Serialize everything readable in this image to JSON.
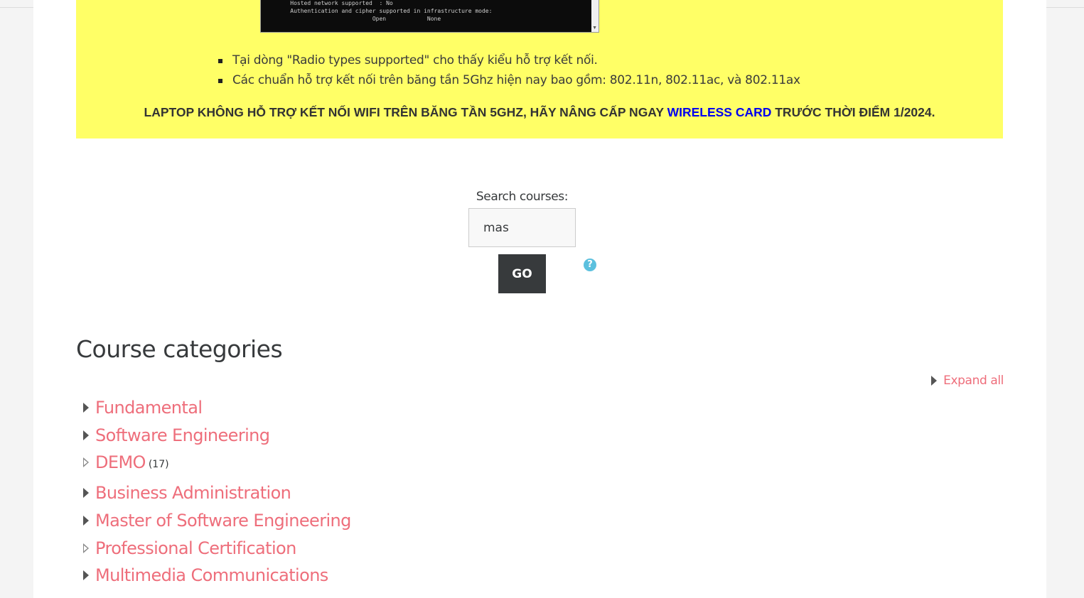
{
  "terminal": {
    "lines": [
      "    Hosted network supported  : No",
      "    Authentication and cipher supported in infrastructure mode:",
      "                            Open            None"
    ]
  },
  "notice": {
    "bullets": [
      "Tại dòng \"Radio types supported\" cho thấy kiểu hỗ trợ kết nối.",
      "Các chuẩn hỗ trợ kết nối trên băng tần 5Ghz hiện nay bao gồm: 802.11n, 802.11ac, và 802.11ax"
    ],
    "warning_before": "LAPTOP KHÔNG HỖ TRỢ KẾT NỐI WIFI TRÊN BĂNG TẦN 5GHZ, HÃY NÂNG CẤP NGAY ",
    "warning_link": "WIRELESS CARD",
    "warning_after": " TRƯỚC THỜI ĐIỂM 1/2024."
  },
  "search": {
    "label": "Search courses:",
    "value": "mas",
    "go_label": "GO",
    "help_glyph": "?"
  },
  "categories": {
    "heading": "Course categories",
    "expand_all": "Expand all",
    "items": [
      {
        "label": "Fundamental",
        "count": "",
        "icon": "collapsed-arrow-icon"
      },
      {
        "label": "Software Engineering",
        "count": "",
        "icon": "collapsed-arrow-icon"
      },
      {
        "label": "DEMO",
        "count": "(17)",
        "icon": "expandable-arrow-icon"
      },
      {
        "label": "Business Administration",
        "count": "",
        "icon": "collapsed-arrow-icon"
      },
      {
        "label": "Master of Software Engineering",
        "count": "",
        "icon": "collapsed-arrow-icon"
      },
      {
        "label": "Professional Certification",
        "count": "",
        "icon": "expandable-arrow-icon"
      },
      {
        "label": "Multimedia Communications",
        "count": "",
        "icon": "collapsed-arrow-icon"
      }
    ]
  },
  "colors": {
    "notice_bg": "#ffff66",
    "link": "#ee6e7b",
    "button": "#373a3c",
    "help": "#5bc0de"
  }
}
